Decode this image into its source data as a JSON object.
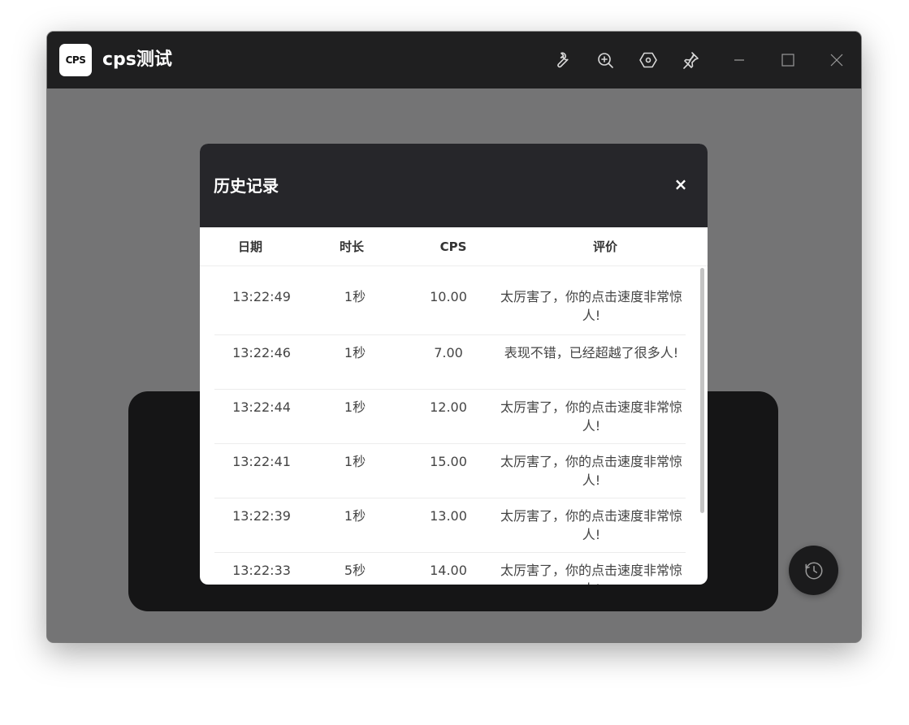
{
  "window": {
    "title": "cps测试",
    "logo_text": "CPS"
  },
  "toolbar": {
    "icons": [
      "wrench-icon",
      "zoom-in-icon",
      "settings-hex-icon",
      "pin-icon",
      "minimize-icon",
      "maximize-icon",
      "close-icon"
    ]
  },
  "modal": {
    "title": "历史记录",
    "close_label": "×",
    "columns": [
      "日期",
      "时长",
      "CPS",
      "评价"
    ],
    "rows": [
      {
        "date": "13:22:49",
        "duration": "1秒",
        "cps": "10.00",
        "evaluation": "太厉害了，你的点击速度非常惊人!"
      },
      {
        "date": "13:22:46",
        "duration": "1秒",
        "cps": "7.00",
        "evaluation": "表现不错，已经超越了很多人!"
      },
      {
        "date": "13:22:44",
        "duration": "1秒",
        "cps": "12.00",
        "evaluation": "太厉害了，你的点击速度非常惊人!"
      },
      {
        "date": "13:22:41",
        "duration": "1秒",
        "cps": "15.00",
        "evaluation": "太厉害了，你的点击速度非常惊人!"
      },
      {
        "date": "13:22:39",
        "duration": "1秒",
        "cps": "13.00",
        "evaluation": "太厉害了，你的点击速度非常惊人!"
      },
      {
        "date": "13:22:33",
        "duration": "5秒",
        "cps": "14.00",
        "evaluation": "太厉害了，你的点击速度非常惊人!"
      }
    ]
  },
  "colors": {
    "titlebar_bg": "#1f1f20",
    "modal_header_bg": "#26262a",
    "overlay": "rgba(0,0,0,0.5)"
  }
}
